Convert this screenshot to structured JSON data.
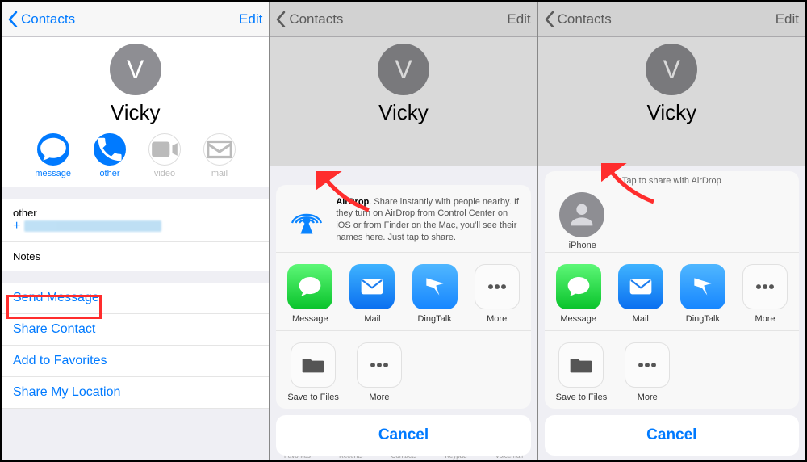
{
  "header": {
    "back": "Contacts",
    "edit": "Edit"
  },
  "contact": {
    "initial": "V",
    "name": "Vicky",
    "actions": [
      {
        "key": "message",
        "label": "message",
        "active": true
      },
      {
        "key": "other",
        "label": "other",
        "active": true
      },
      {
        "key": "video",
        "label": "video",
        "active": false
      },
      {
        "key": "mail",
        "label": "mail",
        "active": false
      }
    ]
  },
  "detail": {
    "phone_label": "other",
    "notes_label": "Notes",
    "links": [
      "Send Message",
      "Share Contact",
      "Add to Favorites",
      "Share My Location"
    ]
  },
  "share": {
    "airdrop_title": "AirDrop",
    "airdrop_body": ". Share instantly with people nearby. If they turn on AirDrop from Control Center on iOS or from Finder on the Mac, you'll see their names here. Just tap to share.",
    "tap_header": "Tap to share with AirDrop",
    "target_label": "iPhone",
    "apps_row1": [
      "Message",
      "Mail",
      "DingTalk",
      "More"
    ],
    "apps_row2": [
      "Save to Files",
      "More"
    ],
    "cancel": "Cancel"
  },
  "tabbar_hint": [
    "Favorites",
    "Recents",
    "Contacts",
    "Keypad",
    "Voicemail"
  ]
}
